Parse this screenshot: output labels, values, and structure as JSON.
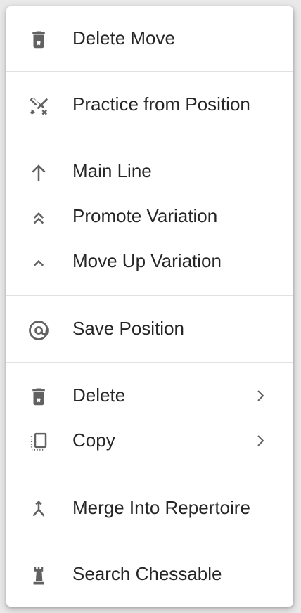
{
  "menu": {
    "items": {
      "delete_move": {
        "label": "Delete Move",
        "icon": "trash-icon"
      },
      "practice": {
        "label": "Practice from Position",
        "icon": "crossed-swords-icon"
      },
      "main_line": {
        "label": "Main Line",
        "icon": "arrow-up-icon"
      },
      "promote": {
        "label": "Promote Variation",
        "icon": "double-chevron-up-icon"
      },
      "move_up": {
        "label": "Move Up Variation",
        "icon": "chevron-up-icon"
      },
      "save_position": {
        "label": "Save Position",
        "icon": "at-sign-icon"
      },
      "delete": {
        "label": "Delete",
        "icon": "trash-icon",
        "submenu": true
      },
      "copy": {
        "label": "Copy",
        "icon": "copy-icon",
        "submenu": true
      },
      "merge": {
        "label": "Merge Into Repertoire",
        "icon": "merge-icon"
      },
      "search": {
        "label": "Search Chessable",
        "icon": "rook-icon"
      }
    }
  },
  "colors": {
    "icon": "#616161",
    "text": "#262626",
    "divider": "#e1e1e1",
    "background": "#ffffff"
  }
}
